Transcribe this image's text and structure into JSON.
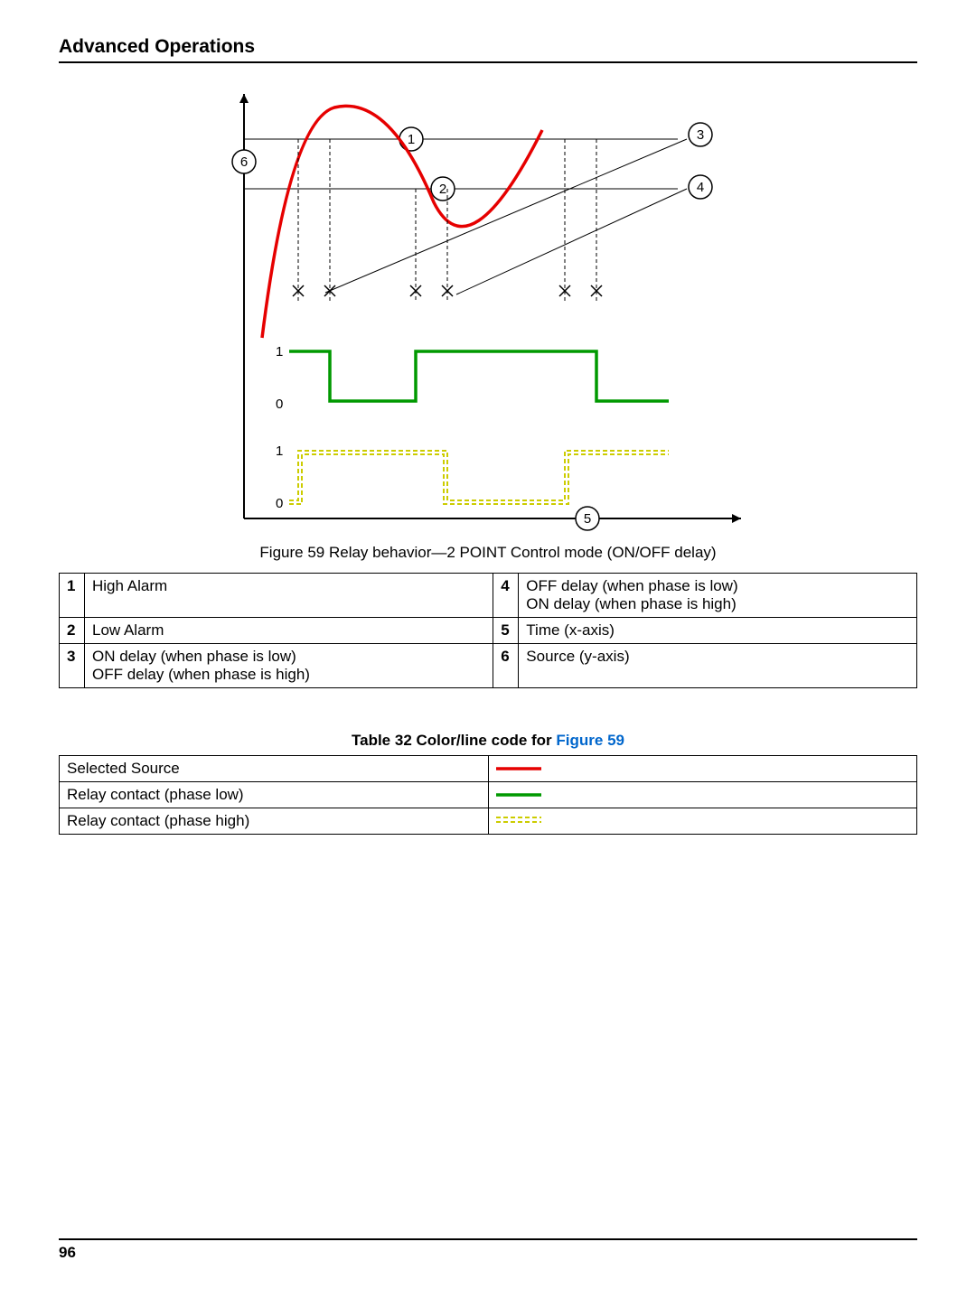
{
  "page_title": "Advanced Operations",
  "figure_caption": "Figure 59  Relay behavior—2 POINT Control mode (ON/OFF delay)",
  "legend": {
    "rows": [
      {
        "n1": "1",
        "t1": "High Alarm",
        "n2": "4",
        "t2": "OFF delay (when phase is low)\nON delay (when phase is high)"
      },
      {
        "n1": "2",
        "t1": "Low Alarm",
        "n2": "5",
        "t2": "Time (x-axis)"
      },
      {
        "n1": "3",
        "t1": "ON delay (when phase is low)\nOFF delay (when phase is high)",
        "n2": "6",
        "t2": "Source (y-axis)"
      }
    ]
  },
  "table_caption_prefix": "Table 32  Color/line code for ",
  "table_caption_link": "Figure 59",
  "color_code": {
    "rows": [
      {
        "label": "Selected Source",
        "type": "red"
      },
      {
        "label": "Relay contact (phase low)",
        "type": "green"
      },
      {
        "label": "Relay contact (phase high)",
        "type": "yellow"
      }
    ]
  },
  "diagram": {
    "callouts": [
      "1",
      "2",
      "3",
      "4",
      "5",
      "6"
    ],
    "axis_labels": [
      "1",
      "0",
      "1",
      "0"
    ]
  },
  "page_number": "96"
}
